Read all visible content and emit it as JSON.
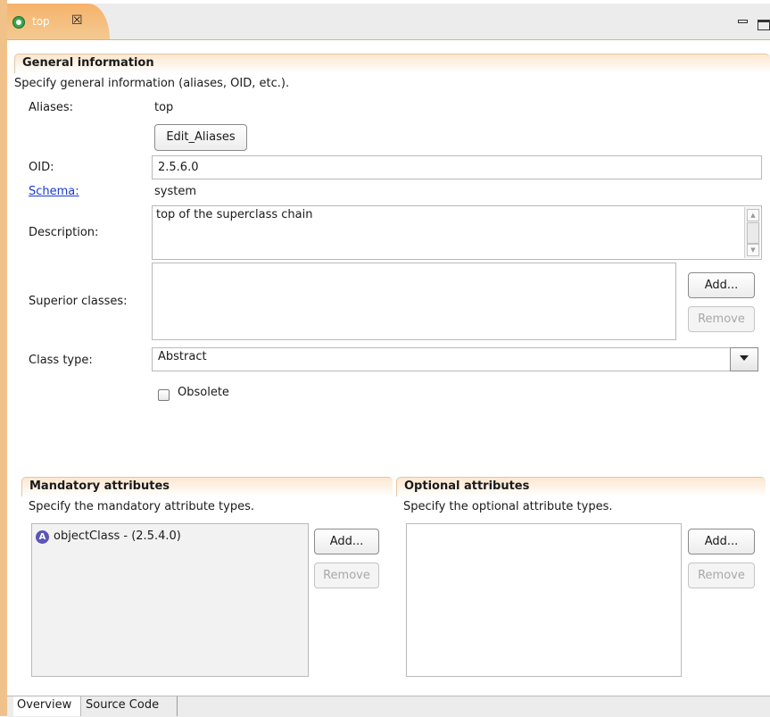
{
  "editor_tab": {
    "label": "top",
    "close": "☒"
  },
  "general": {
    "title": "General information",
    "description": "Specify general information (aliases, OID, etc.).",
    "aliases_label": "Aliases:",
    "aliases_value": "top",
    "edit_aliases_button": "Edit_Aliases",
    "oid_label": "OID:",
    "oid_value": "2.5.6.0",
    "schema_label": "Schema:",
    "schema_value": "system",
    "description_label": "Description:",
    "description_value": "top of the superclass chain",
    "superior_label": "Superior classes:",
    "add_button": "Add...",
    "remove_button": "Remove",
    "class_type_label": "Class type:",
    "class_type_value": "Abstract",
    "obsolete_label": "Obsolete"
  },
  "mandatory": {
    "title": "Mandatory attributes",
    "description": "Specify the mandatory attribute types.",
    "items": [
      {
        "icon": "A",
        "name": "objectClass  -  (2.5.4.0)"
      }
    ],
    "add_button": "Add...",
    "remove_button": "Remove"
  },
  "optional": {
    "title": "Optional attributes",
    "description": "Specify the optional attribute types.",
    "add_button": "Add...",
    "remove_button": "Remove"
  },
  "bottom_tabs": [
    "Overview",
    "Source Code"
  ]
}
